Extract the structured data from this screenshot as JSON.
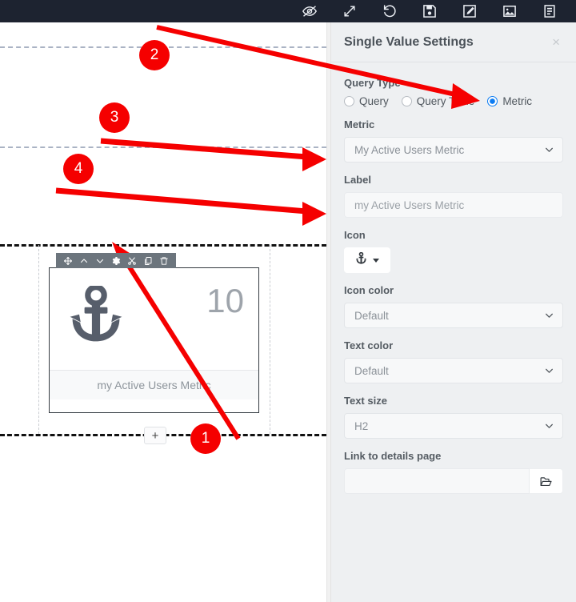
{
  "toolbar": {
    "buttons": [
      {
        "name": "eye-slash-icon",
        "label": "Hide"
      },
      {
        "name": "expand-arrows-icon",
        "label": "Fullscreen"
      },
      {
        "name": "undo-icon",
        "label": "Undo"
      },
      {
        "name": "save-icon",
        "label": "Save"
      },
      {
        "name": "edit-pencil-icon",
        "label": "Edit"
      },
      {
        "name": "image-icon",
        "label": "Image"
      },
      {
        "name": "document-icon",
        "label": "Document"
      }
    ]
  },
  "canvas": {
    "widget": {
      "icon": "anchor-icon",
      "value": "10",
      "label": "my Active Users Metric",
      "toolbar_buttons": [
        {
          "name": "move-icon",
          "label": "Move"
        },
        {
          "name": "chevron-up-icon",
          "label": "Move up"
        },
        {
          "name": "chevron-down-icon",
          "label": "Move down"
        },
        {
          "name": "gear-icon",
          "label": "Settings"
        },
        {
          "name": "scissors-icon",
          "label": "Cut"
        },
        {
          "name": "copy-icon",
          "label": "Copy"
        },
        {
          "name": "trash-icon",
          "label": "Delete"
        }
      ]
    },
    "add_button_label": "+"
  },
  "panel": {
    "title": "Single Value Settings",
    "close_label": "×",
    "query_type": {
      "label": "Query Type",
      "options": [
        {
          "label": "Query",
          "selected": false
        },
        {
          "label": "Query Table",
          "selected": false
        },
        {
          "label": "Metric",
          "selected": true
        }
      ]
    },
    "metric": {
      "label": "Metric",
      "value": "My Active Users Metric"
    },
    "label_field": {
      "label": "Label",
      "value": "my Active Users Metric"
    },
    "icon_field": {
      "label": "Icon",
      "value": "anchor-icon"
    },
    "icon_color": {
      "label": "Icon color",
      "value": "Default"
    },
    "text_color": {
      "label": "Text color",
      "value": "Default"
    },
    "text_size": {
      "label": "Text size",
      "value": "H2"
    },
    "link_details": {
      "label": "Link to details page",
      "value": "",
      "browse_icon": "folder-open-icon"
    }
  },
  "annotations": {
    "badges": [
      {
        "number": "1"
      },
      {
        "number": "2"
      },
      {
        "number": "3"
      },
      {
        "number": "4"
      }
    ],
    "color": "#f50000"
  }
}
